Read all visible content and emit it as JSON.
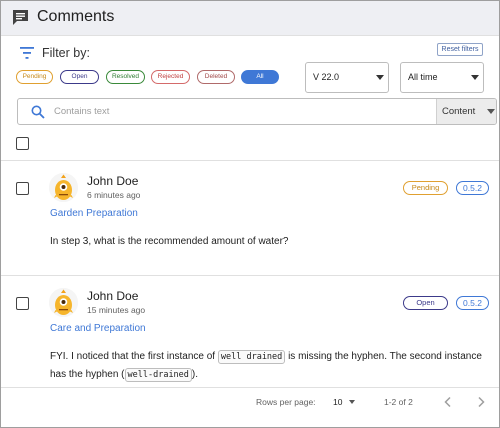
{
  "header": {
    "title": "Comments",
    "icon": "comment-icon"
  },
  "filters": {
    "label": "Filter by:",
    "reset_label": "Reset filters",
    "chips": {
      "pending": "Pending",
      "open": "Open",
      "resolved": "Resolved",
      "rejected": "Rejected",
      "deleted": "Deleted",
      "all": "All"
    },
    "selected_chip": "All",
    "version_select": "V 22.0",
    "time_select": "All time"
  },
  "search": {
    "placeholder": "Contains text",
    "scope": "Content"
  },
  "comments": [
    {
      "author": "John Doe",
      "time": "6 minutes ago",
      "topic": "Garden Preparation",
      "body": "In step 3, what is the recommended amount of water?",
      "status": "Pending",
      "version": "0.5.2"
    },
    {
      "author": "John Doe",
      "time": "15 minutes ago",
      "topic": "Care and Preparation",
      "body_parts": {
        "p1": "FYI. I noticed that the first instance of ",
        "code1": "well drained",
        "p2": " is missing the hyphen. The second instance has the hyphen (",
        "code2": "well-drained",
        "p3": ")."
      },
      "status": "Open",
      "version": "0.5.2"
    }
  ],
  "pagination": {
    "rows_label": "Rows per page:",
    "rows_value": "10",
    "range": "1-2 of 2"
  },
  "colors": {
    "accent": "#3f78d6",
    "pending": "#e0a030",
    "open": "#3c3a8a",
    "resolved": "#2e7d32",
    "rejected": "#c04040",
    "header_bg": "#eeeff3"
  }
}
